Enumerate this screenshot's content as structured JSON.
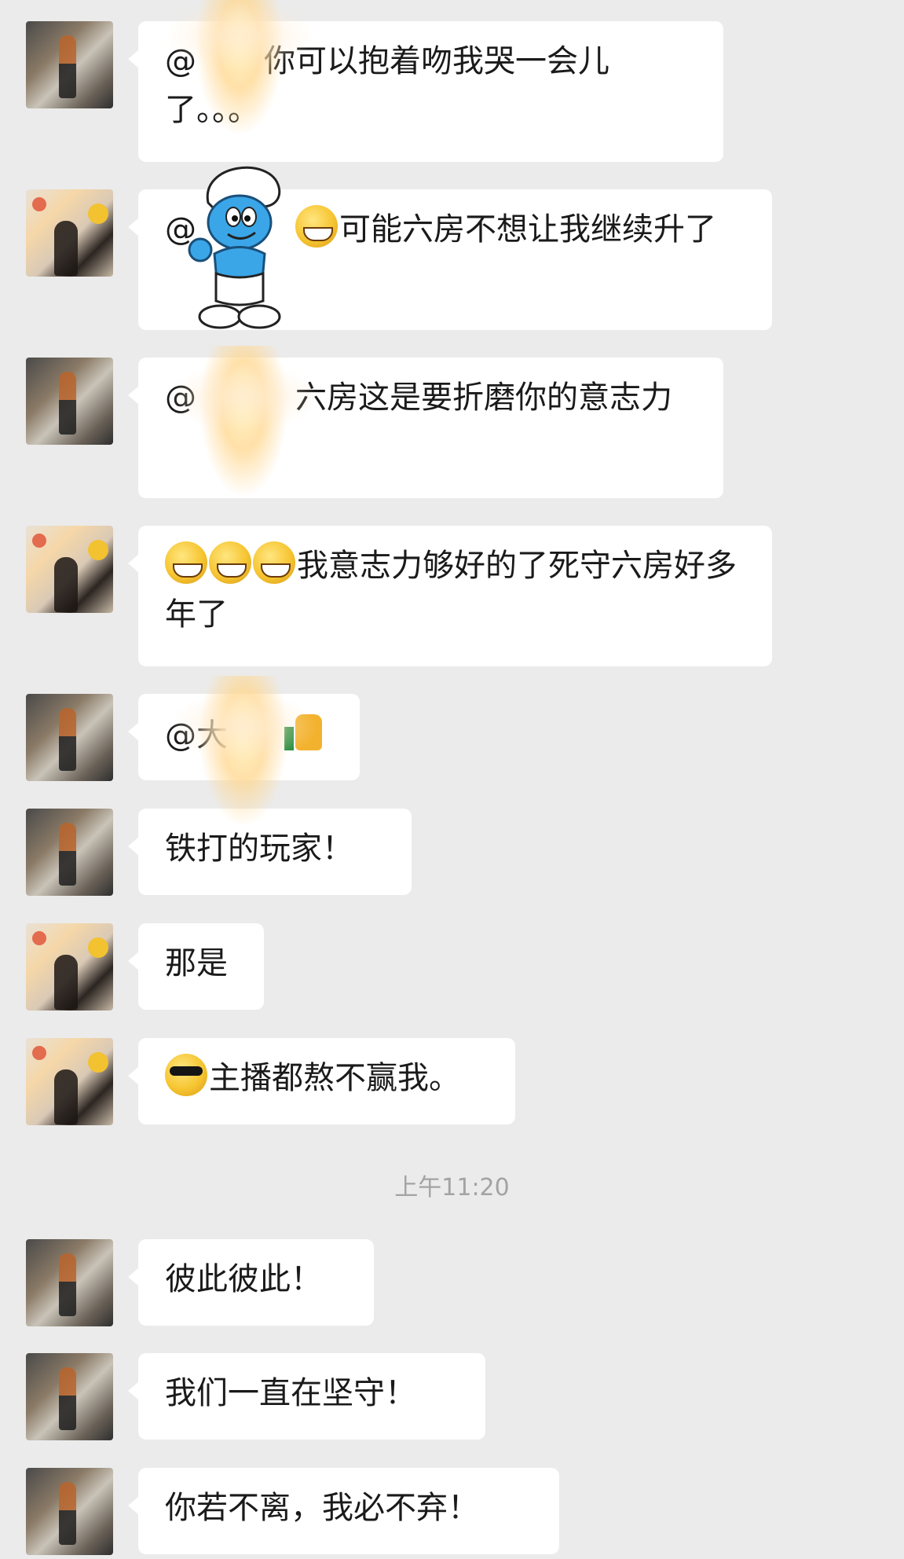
{
  "messages": [
    {
      "avatar": "a",
      "parts": [
        {
          "t": "@"
        },
        {
          "t": "你可以抱着吻我哭一会儿了。。。"
        }
      ]
    },
    {
      "avatar": "b",
      "parts": [
        {
          "t": "@"
        },
        {
          "emoji": "grin-emoji"
        },
        {
          "t": "可能六房不想让我继续升了"
        }
      ]
    },
    {
      "avatar": "a",
      "parts": [
        {
          "t": "@"
        },
        {
          "t": "六房这是要折磨你的意志力"
        }
      ]
    },
    {
      "avatar": "b",
      "parts": [
        {
          "emoji": "grin-emoji"
        },
        {
          "emoji": "grin-emoji"
        },
        {
          "emoji": "grin-emoji"
        },
        {
          "t": "我意志力够好的了死守六房好多年了"
        }
      ]
    },
    {
      "avatar": "a",
      "parts": [
        {
          "t": "@大"
        },
        {
          "emoji": "thumbs-up-emoji"
        }
      ]
    },
    {
      "avatar": "a",
      "parts": [
        {
          "t": "铁打的玩家！"
        }
      ]
    },
    {
      "avatar": "b",
      "parts": [
        {
          "t": "那是"
        }
      ]
    },
    {
      "avatar": "b",
      "parts": [
        {
          "emoji": "cool-emoji"
        },
        {
          "t": "主播都熬不赢我。"
        }
      ]
    },
    {
      "avatar": "a",
      "parts": [
        {
          "t": "彼此彼此！"
        }
      ]
    },
    {
      "avatar": "a",
      "parts": [
        {
          "t": "我们一直在坚守！"
        }
      ]
    },
    {
      "avatar": "a",
      "parts": [
        {
          "t": "你若不离，我必不弃！"
        }
      ]
    }
  ],
  "separator": {
    "time": "上午11:20"
  },
  "stickers": [
    "fairy-sticker",
    "smurf-sticker"
  ]
}
